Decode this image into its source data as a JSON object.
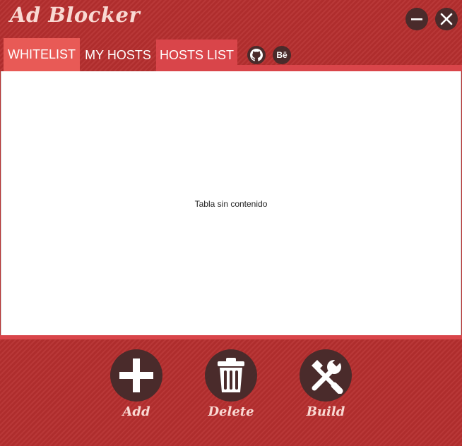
{
  "app": {
    "title": "Ad Blocker"
  },
  "window_controls": {
    "minimize_icon": "minimize-icon",
    "close_icon": "close-icon"
  },
  "tabs": [
    {
      "label": "WHITELIST",
      "active": true
    },
    {
      "label": "MY HOSTS",
      "active": false
    },
    {
      "label": "HOSTS LIST",
      "active": false
    }
  ],
  "social": [
    {
      "icon": "github-icon"
    },
    {
      "icon": "behance-icon",
      "glyph": "Bē"
    }
  ],
  "table": {
    "empty_message": "Tabla sin contenido"
  },
  "actions": [
    {
      "label": "Add",
      "icon": "plus-icon"
    },
    {
      "label": "Delete",
      "icon": "trash-icon"
    },
    {
      "label": "Build",
      "icon": "tools-icon"
    }
  ],
  "colors": {
    "background": "#b62f2f",
    "active_tab": "#e85a56",
    "accent_strip": "#d9454a",
    "button_dark": "#4a2b2b",
    "title_text": "#f9d9d3"
  }
}
